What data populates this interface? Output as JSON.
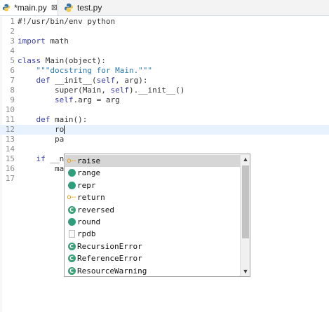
{
  "tabs": [
    {
      "label": "*main.py",
      "close": "⊠"
    },
    {
      "label": "test.py"
    }
  ],
  "code_lines": [
    {
      "n": "1",
      "parts": [
        {
          "t": "#!/usr/bin/env python",
          "c": ""
        }
      ]
    },
    {
      "n": "2",
      "parts": []
    },
    {
      "n": "3",
      "parts": [
        {
          "t": "import",
          "c": "kw"
        },
        {
          "t": " math",
          "c": ""
        }
      ]
    },
    {
      "n": "4",
      "parts": []
    },
    {
      "n": "5",
      "parts": [
        {
          "t": "class",
          "c": "kw"
        },
        {
          "t": " Main(object):",
          "c": ""
        }
      ]
    },
    {
      "n": "6",
      "parts": [
        {
          "t": "    \"\"\"docstring for Main.\"\"\"",
          "c": "str"
        }
      ]
    },
    {
      "n": "7",
      "parts": [
        {
          "t": "    ",
          "c": ""
        },
        {
          "t": "def",
          "c": "kw"
        },
        {
          "t": " __init__(",
          "c": ""
        },
        {
          "t": "self",
          "c": "self"
        },
        {
          "t": ", arg):",
          "c": ""
        }
      ]
    },
    {
      "n": "8",
      "parts": [
        {
          "t": "        super(Main, ",
          "c": ""
        },
        {
          "t": "self",
          "c": "self"
        },
        {
          "t": ").__init__()",
          "c": ""
        }
      ]
    },
    {
      "n": "9",
      "parts": [
        {
          "t": "        ",
          "c": ""
        },
        {
          "t": "self",
          "c": "self"
        },
        {
          "t": ".arg = arg",
          "c": ""
        }
      ]
    },
    {
      "n": "10",
      "parts": []
    },
    {
      "n": "11",
      "parts": [
        {
          "t": "    ",
          "c": ""
        },
        {
          "t": "def",
          "c": "kw"
        },
        {
          "t": " main():",
          "c": ""
        }
      ]
    },
    {
      "n": "12",
      "parts": [
        {
          "t": "        ro",
          "c": ""
        }
      ]
    },
    {
      "n": "13",
      "parts": [
        {
          "t": "        pa",
          "c": ""
        }
      ]
    },
    {
      "n": "14",
      "parts": []
    },
    {
      "n": "15",
      "parts": [
        {
          "t": "    ",
          "c": ""
        },
        {
          "t": "if",
          "c": "kw"
        },
        {
          "t": " __n",
          "c": ""
        }
      ]
    },
    {
      "n": "16",
      "parts": [
        {
          "t": "        ma",
          "c": ""
        }
      ]
    },
    {
      "n": "17",
      "parts": []
    }
  ],
  "completions": [
    {
      "label": "raise",
      "icon": "keyword-icon",
      "selected": true
    },
    {
      "label": "range",
      "icon": "function-icon"
    },
    {
      "label": "repr",
      "icon": "function-icon"
    },
    {
      "label": "return",
      "icon": "keyword-icon"
    },
    {
      "label": "reversed",
      "icon": "class-icon"
    },
    {
      "label": "round",
      "icon": "function-icon"
    },
    {
      "label": "rpdb",
      "icon": "file-icon"
    },
    {
      "label": "RecursionError",
      "icon": "class-icon"
    },
    {
      "label": "ReferenceError",
      "icon": "class-icon"
    },
    {
      "label": "ResourceWarning",
      "icon": "class-icon"
    }
  ],
  "scroll": {
    "up": "▲",
    "down": "▼"
  },
  "icon_glyphs": {
    "keyword-icon": "o‑‑",
    "class-icon": "C"
  }
}
